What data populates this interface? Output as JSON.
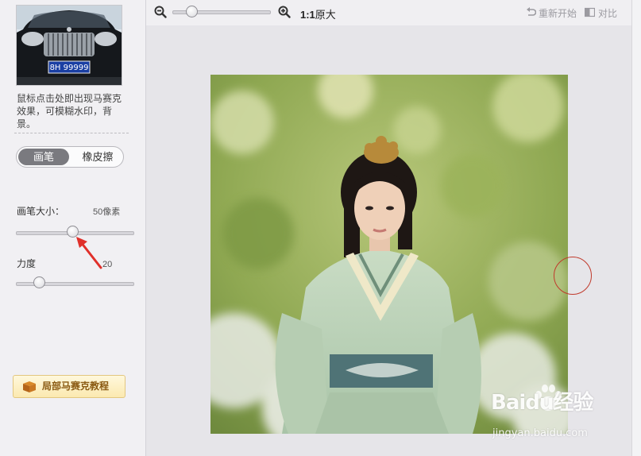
{
  "left_panel": {
    "thumbnail": {
      "plate_text": "8H 99999"
    },
    "instruction": "鼠标点击处即出现马赛克效果，可模糊水印，背景。",
    "mode_toggle": {
      "brush_label": "画笔",
      "eraser_label": "橡皮擦",
      "selected": "brush"
    },
    "brush_size": {
      "label": "画笔大小：",
      "value_text": "50像素",
      "slider_fraction": 0.48
    },
    "strength": {
      "label": "力度",
      "value_text": "20",
      "slider_fraction": 0.2
    },
    "tutorial_button": {
      "label": "局部马赛克教程",
      "icon": "box-icon"
    }
  },
  "toolbar": {
    "zoom_out_icon": "zoom-out-icon",
    "zoom_in_icon": "zoom-in-icon",
    "zoom_slider_fraction": 0.2,
    "ratio_label": "1:1",
    "original_size_label": "原大",
    "restart_label": "重新开始",
    "compare_label": "对比"
  },
  "canvas": {
    "watermark_text": "Baidu经验",
    "watermark_subtext": "jingyan.baidu.com"
  },
  "colors": {
    "brush_cursor": "#c0392b",
    "toggle_active": "#7a7a7f",
    "tutorial_text": "#8a5a12"
  }
}
